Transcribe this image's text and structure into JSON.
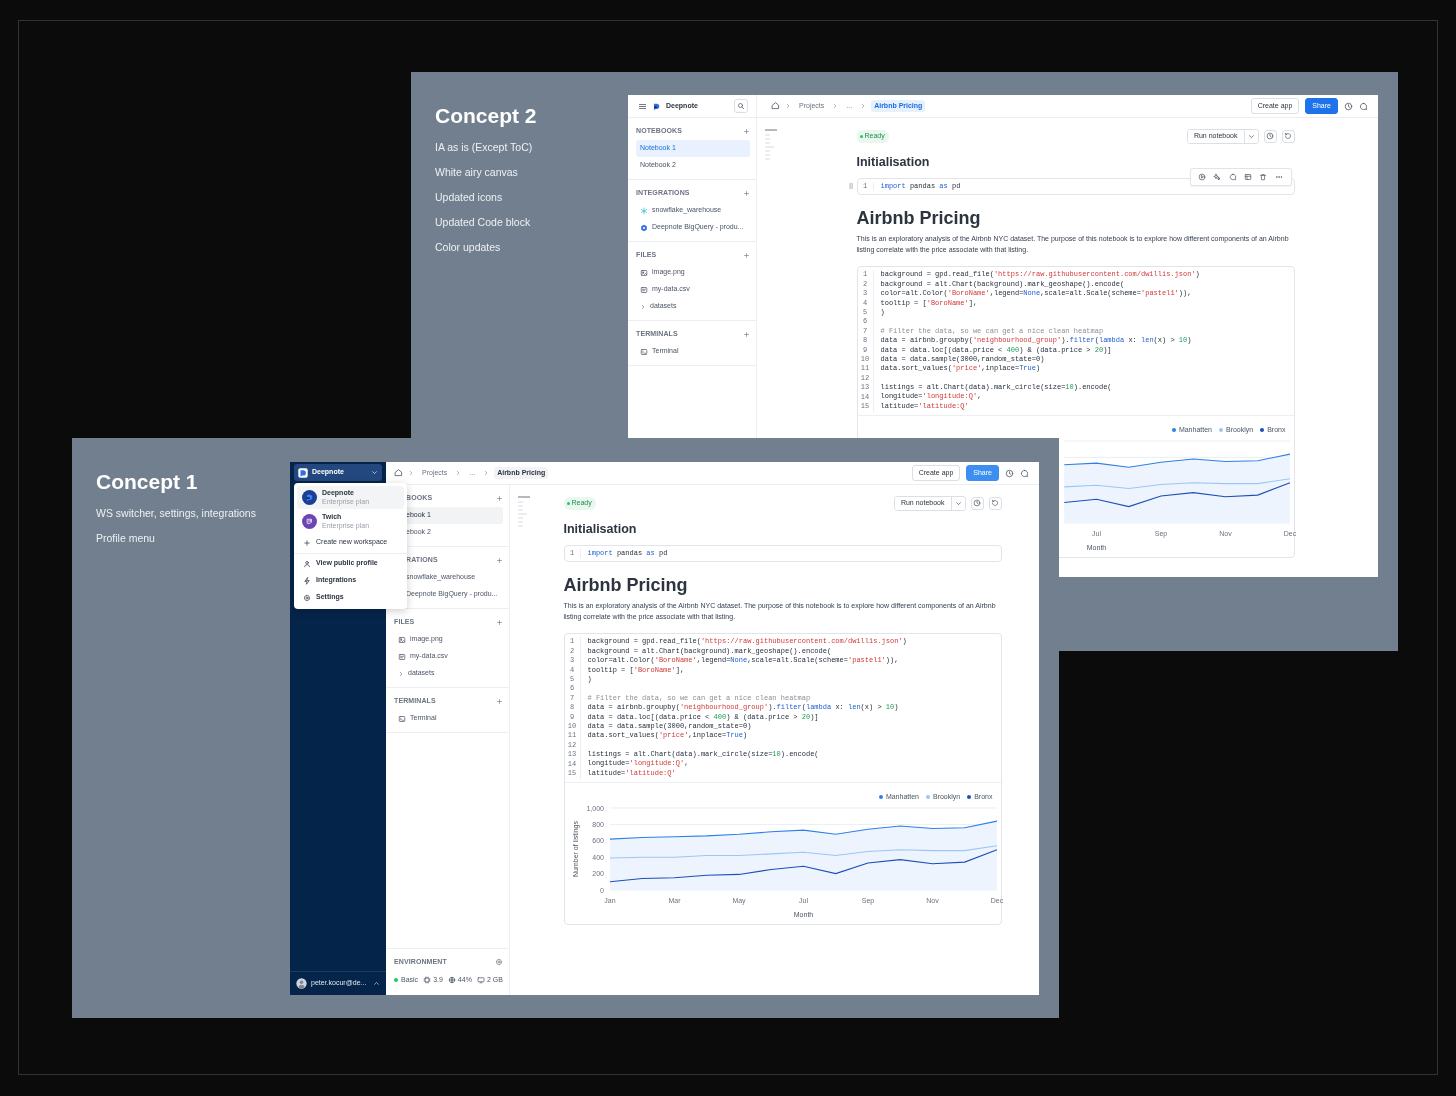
{
  "slides": [
    {
      "title": "Concept 2",
      "notes": [
        "IA as is (Except ToC)",
        "White airy canvas",
        "Updated icons",
        "Updated Code block",
        "Color updates"
      ],
      "app": {
        "header": {
          "title": "Deepnote"
        },
        "breadcrumbs": [
          {
            "label": "Projects",
            "selected": false
          },
          {
            "label": "...",
            "selected": false
          },
          {
            "label": "Airbnb Pricing",
            "selected": true
          }
        ],
        "actions": [
          "Create app",
          "Share"
        ],
        "sidebar": {
          "sections": [
            {
              "title": "NOTEBOOKS",
              "items": [
                {
                  "label": "Notebook 1",
                  "selected": true
                },
                {
                  "label": "Notebook 2",
                  "selected": false
                }
              ]
            },
            {
              "title": "INTEGRATIONS",
              "items": [
                {
                  "label": "snowflake_warehouse",
                  "selected": false
                },
                {
                  "label": "Deepnote BigQuery - produ...",
                  "selected": false
                }
              ]
            },
            {
              "title": "FILES",
              "items": [
                {
                  "label": "image.png",
                  "selected": false
                },
                {
                  "label": "my-data.csv",
                  "selected": false
                },
                {
                  "label": "datasets",
                  "selected": false
                }
              ]
            },
            {
              "title": "TERMINALS",
              "items": [
                {
                  "label": "Terminal",
                  "selected": false
                }
              ]
            }
          ]
        },
        "status": "Ready",
        "run_label": "Run notebook",
        "heading": "Initialisation",
        "import_cell": {
          "hovered": true,
          "lines": [
            {
              "no": "1",
              "tokens": [
                {
                  "kind": "kw",
                  "text": "import"
                },
                {
                  "kind": "txt",
                  "text": " pandas "
                },
                {
                  "kind": "kw",
                  "text": "as"
                },
                {
                  "kind": "txt",
                  "text": " pd"
                }
              ]
            }
          ]
        },
        "title": "Airbnb Pricing",
        "description": "This is an exploratory analysis of the Airbnb NYC dataset. The purpose of this notebook is to explore how different components of an Airbnb listing correlate with the price associate with that listing.",
        "code": {
          "lines": [
            {
              "no": "1",
              "tokens": [
                {
                  "kind": "txt",
                  "text": "background = gpd.read_file("
                },
                {
                  "kind": "str",
                  "text": "'https://raw.githubusercontent.com/dwillis.json'"
                },
                {
                  "kind": "txt",
                  "text": ")"
                }
              ]
            },
            {
              "no": "2",
              "tokens": [
                {
                  "kind": "txt",
                  "text": "background = alt.Chart(background).mark_geoshape().encode("
                }
              ]
            },
            {
              "no": "3",
              "tokens": [
                {
                  "kind": "txt",
                  "text": "color=alt.Color("
                },
                {
                  "kind": "str",
                  "text": "'BoroName'"
                },
                {
                  "kind": "txt",
                  "text": ",legend="
                },
                {
                  "kind": "kw",
                  "text": "None"
                },
                {
                  "kind": "txt",
                  "text": ",scale=alt.Scale(scheme="
                },
                {
                  "kind": "str",
                  "text": "'pastel1'"
                },
                {
                  "kind": "txt",
                  "text": ")),"
                }
              ]
            },
            {
              "no": "4",
              "tokens": [
                {
                  "kind": "txt",
                  "text": "tooltip = ["
                },
                {
                  "kind": "str",
                  "text": "'BoroName'"
                },
                {
                  "kind": "txt",
                  "text": "],"
                }
              ]
            },
            {
              "no": "5",
              "tokens": [
                {
                  "kind": "txt",
                  "text": ")"
                }
              ]
            },
            {
              "no": "6"
            },
            {
              "no": "7",
              "tokens": [
                {
                  "kind": "com",
                  "text": "# Filter the data, so we can get a nice clean heatmap"
                }
              ]
            },
            {
              "no": "8",
              "tokens": [
                {
                  "kind": "txt",
                  "text": "data = airbnb.groupby("
                },
                {
                  "kind": "str",
                  "text": "'neighbourhood_group'"
                },
                {
                  "kind": "txt",
                  "text": ")."
                },
                {
                  "kind": "kw",
                  "text": "filter"
                },
                {
                  "kind": "txt",
                  "text": "("
                },
                {
                  "kind": "kw",
                  "text": "lambda"
                },
                {
                  "kind": "txt",
                  "text": " x: "
                },
                {
                  "kind": "kw",
                  "text": "len"
                },
                {
                  "kind": "txt",
                  "text": "(x) > "
                },
                {
                  "kind": "num",
                  "text": "10"
                },
                {
                  "kind": "txt",
                  "text": ")"
                }
              ]
            },
            {
              "no": "9",
              "tokens": [
                {
                  "kind": "txt",
                  "text": "data = data.loc[(data.price < "
                },
                {
                  "kind": "num",
                  "text": "400"
                },
                {
                  "kind": "txt",
                  "text": ") & (data.price > "
                },
                {
                  "kind": "num",
                  "text": "20"
                },
                {
                  "kind": "txt",
                  "text": ")]"
                }
              ]
            },
            {
              "no": "10",
              "tokens": [
                {
                  "kind": "txt",
                  "text": "data = data.sample(3000,random_state=0)"
                }
              ]
            },
            {
              "no": "11",
              "tokens": [
                {
                  "kind": "txt",
                  "text": "data.sort_values("
                },
                {
                  "kind": "str",
                  "text": "'price'"
                },
                {
                  "kind": "txt",
                  "text": ",inplace="
                },
                {
                  "kind": "kw",
                  "text": "True"
                },
                {
                  "kind": "txt",
                  "text": ")"
                }
              ]
            },
            {
              "no": "12"
            },
            {
              "no": "13",
              "tokens": [
                {
                  "kind": "txt",
                  "text": "listings = alt.Chart(data).mark_circle(size="
                },
                {
                  "kind": "num",
                  "text": "10"
                },
                {
                  "kind": "txt",
                  "text": ").encode("
                }
              ]
            },
            {
              "no": "14",
              "tokens": [
                {
                  "kind": "txt",
                  "text": "longitude="
                },
                {
                  "kind": "str",
                  "text": "'longitude:Q'"
                },
                {
                  "kind": "txt",
                  "text": ","
                }
              ]
            },
            {
              "no": "15",
              "tokens": [
                {
                  "kind": "txt",
                  "text": "latitude="
                },
                {
                  "kind": "str",
                  "text": "'latitude:Q'"
                }
              ]
            }
          ]
        },
        "chart": {
          "legend": [
            {
              "name": "Manhatten",
              "color": "#2f7fe8"
            },
            {
              "name": "Brooklyn",
              "color": "#9cc6f7"
            },
            {
              "name": "Bronx",
              "color": "#1d4fb8"
            }
          ],
          "x_labels": [
            "Jul",
            "Sep",
            "Nov",
            "Dec"
          ],
          "xlabel": "Month"
        }
      }
    },
    {
      "title": "Concept 1",
      "notes": [
        "WS switcher, settings, integrations",
        "Profile menu"
      ],
      "app": {
        "rail": {
          "switcher": {
            "label": "Deepnote",
            "expanded": true
          },
          "menu": {
            "workspaces": [
              {
                "name": "Deepnote",
                "plan": "Enterprise plan",
                "color": "#1c3f94",
                "selected": true
              },
              {
                "name": "Twich",
                "plan": "Enterprise plan",
                "color": "#6c45b5",
                "selected": false
              }
            ],
            "create": "Create new workspace",
            "items": [
              "View public profile",
              "Integrations",
              "Settings"
            ]
          },
          "profile": {
            "email": "peter.kocur@de..."
          }
        },
        "breadcrumbs": [
          {
            "label": "Projects",
            "selected": false
          },
          {
            "label": "...",
            "selected": false
          },
          {
            "label": "Airbnb Pricing",
            "selected": true
          }
        ],
        "actions": [
          "Create app",
          "Share"
        ],
        "sidebar": {
          "sections": [
            {
              "title": "BOOKS",
              "clipped": true,
              "items": [
                {
                  "label": "ebook 1",
                  "selected": true,
                  "kind": "clipped"
                },
                {
                  "label": "ebook 2",
                  "selected": false,
                  "kind": "clipped"
                }
              ]
            },
            {
              "title": "RATIONS",
              "clipped": true,
              "items": [
                {
                  "label": "snowflake_warehouse",
                  "selected": false,
                  "kind": "clipped"
                },
                {
                  "label": "Deepnote BigQuery - produ...",
                  "selected": false,
                  "kind": "clipped"
                }
              ]
            },
            {
              "title": "FILES",
              "items": [
                {
                  "label": "image.png",
                  "selected": false,
                  "kind": "item"
                },
                {
                  "label": "my-data.csv",
                  "selected": false,
                  "kind": "item"
                },
                {
                  "label": "datasets",
                  "selected": false,
                  "kind": "item"
                }
              ]
            },
            {
              "title": "TERMINALS",
              "items": [
                {
                  "label": "Terminal",
                  "selected": false,
                  "kind": "item"
                }
              ]
            }
          ],
          "environment": {
            "title": "ENVIRONMENT",
            "status": "Basic",
            "stats": [
              "3.9",
              "44%",
              "2 GB"
            ]
          }
        },
        "status": "Ready",
        "run_label": "Run notebook",
        "heading": "Initialisation",
        "import_cell": {
          "lines": [
            {
              "no": "1",
              "tokens": [
                {
                  "kind": "kw",
                  "text": "import"
                },
                {
                  "kind": "txt",
                  "text": " pandas "
                },
                {
                  "kind": "kw",
                  "text": "as"
                },
                {
                  "kind": "txt",
                  "text": " pd"
                }
              ]
            }
          ]
        },
        "title": "Airbnb Pricing",
        "description": "This is an exploratory analysis of the Airbnb NYC dataset. The purpose of this notebook is to explore how different components of an Airbnb listing correlate with the price associate with that listing.",
        "code": {
          "lines": [
            {
              "no": "1",
              "tokens": [
                {
                  "kind": "txt",
                  "text": "background = gpd.read_file("
                },
                {
                  "kind": "str",
                  "text": "'https://raw.githubusercontent.com/dwillis.json'"
                },
                {
                  "kind": "txt",
                  "text": ")"
                }
              ]
            },
            {
              "no": "2",
              "tokens": [
                {
                  "kind": "txt",
                  "text": "background = alt.Chart(background).mark_geoshape().encode("
                }
              ]
            },
            {
              "no": "3",
              "tokens": [
                {
                  "kind": "txt",
                  "text": "color=alt.Color("
                },
                {
                  "kind": "str",
                  "text": "'BoroName'"
                },
                {
                  "kind": "txt",
                  "text": ",legend="
                },
                {
                  "kind": "kw",
                  "text": "None"
                },
                {
                  "kind": "txt",
                  "text": ",scale=alt.Scale(scheme="
                },
                {
                  "kind": "str",
                  "text": "'pastel1'"
                },
                {
                  "kind": "txt",
                  "text": ")),"
                }
              ]
            },
            {
              "no": "4",
              "tokens": [
                {
                  "kind": "txt",
                  "text": "tooltip = ["
                },
                {
                  "kind": "str",
                  "text": "'BoroName'"
                },
                {
                  "kind": "txt",
                  "text": "],"
                }
              ]
            },
            {
              "no": "5",
              "tokens": [
                {
                  "kind": "txt",
                  "text": ")"
                }
              ]
            },
            {
              "no": "6"
            },
            {
              "no": "7",
              "tokens": [
                {
                  "kind": "com",
                  "text": "# Filter the data, so we can get a nice clean heatmap"
                }
              ]
            },
            {
              "no": "8",
              "tokens": [
                {
                  "kind": "txt",
                  "text": "data = airbnb.groupby("
                },
                {
                  "kind": "str",
                  "text": "'neighbourhood_group'"
                },
                {
                  "kind": "txt",
                  "text": ")."
                },
                {
                  "kind": "kw",
                  "text": "filter"
                },
                {
                  "kind": "txt",
                  "text": "("
                },
                {
                  "kind": "kw",
                  "text": "lambda"
                },
                {
                  "kind": "txt",
                  "text": " x: "
                },
                {
                  "kind": "kw",
                  "text": "len"
                },
                {
                  "kind": "txt",
                  "text": "(x) > "
                },
                {
                  "kind": "num",
                  "text": "10"
                },
                {
                  "kind": "txt",
                  "text": ")"
                }
              ]
            },
            {
              "no": "9",
              "tokens": [
                {
                  "kind": "txt",
                  "text": "data = data.loc[(data.price < "
                },
                {
                  "kind": "num",
                  "text": "400"
                },
                {
                  "kind": "txt",
                  "text": ") & (data.price > "
                },
                {
                  "kind": "num",
                  "text": "20"
                },
                {
                  "kind": "txt",
                  "text": ")]"
                }
              ]
            },
            {
              "no": "10",
              "tokens": [
                {
                  "kind": "txt",
                  "text": "data = data.sample(3000,random_state=0)"
                }
              ]
            },
            {
              "no": "11",
              "tokens": [
                {
                  "kind": "txt",
                  "text": "data.sort_values("
                },
                {
                  "kind": "str",
                  "text": "'price'"
                },
                {
                  "kind": "txt",
                  "text": ",inplace="
                },
                {
                  "kind": "kw",
                  "text": "True"
                },
                {
                  "kind": "txt",
                  "text": ")"
                }
              ]
            },
            {
              "no": "12"
            },
            {
              "no": "13",
              "tokens": [
                {
                  "kind": "txt",
                  "text": "listings = alt.Chart(data).mark_circle(size="
                },
                {
                  "kind": "num",
                  "text": "10"
                },
                {
                  "kind": "txt",
                  "text": ").encode("
                }
              ]
            },
            {
              "no": "14",
              "tokens": [
                {
                  "kind": "txt",
                  "text": "longitude="
                },
                {
                  "kind": "str",
                  "text": "'longitude:Q'"
                },
                {
                  "kind": "txt",
                  "text": ","
                }
              ]
            },
            {
              "no": "15",
              "tokens": [
                {
                  "kind": "txt",
                  "text": "latitude="
                },
                {
                  "kind": "str",
                  "text": "'latitude:Q'"
                }
              ]
            }
          ]
        },
        "chart": {
          "chart_data": {
            "type": "line",
            "legend": "top-right",
            "xlabel": "Month",
            "ylabel": "Number of listings",
            "categories": [
              "Jan",
              null,
              "Mar",
              null,
              "May",
              null,
              "Jul",
              null,
              "Sep",
              null,
              "Nov",
              null,
              "Dec"
            ],
            "ylim": [
              0,
              1000
            ],
            "yticks": [
              0,
              200,
              400,
              600,
              800,
              {
                "value": 1000,
                "label": "1,000"
              }
            ],
            "series": [
              {
                "name": "Manhatten",
                "type": "area",
                "color": "#2f7fe8",
                "values": [
                  620,
                  640,
                  650,
                  660,
                  680,
                  710,
                  730,
                  680,
                  740,
                  780,
                  750,
                  760,
                  840
                ]
              },
              {
                "name": "Brooklyn",
                "type": "line",
                "color": "#9cc6f7",
                "values": [
                  390,
                  400,
                  400,
                  420,
                  420,
                  440,
                  460,
                  420,
                  470,
                  490,
                  480,
                  480,
                  540
                ]
              },
              {
                "name": "Bronx",
                "type": "line",
                "color": "#1d4fb8",
                "values": [
                  100,
                  140,
                  150,
                  180,
                  190,
                  250,
                  290,
                  200,
                  330,
                  370,
                  320,
                  340,
                  490
                ]
              }
            ]
          }
        }
      }
    }
  ]
}
